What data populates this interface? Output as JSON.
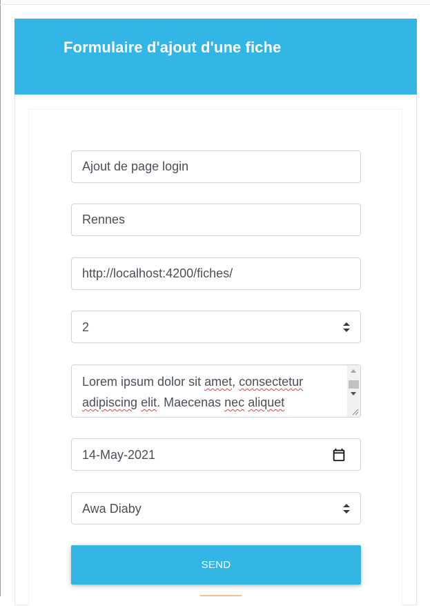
{
  "form": {
    "title": "Formulaire d'ajout d'une fiche",
    "fields": {
      "title_value": "Ajout de page login",
      "city_value": "Rennes",
      "url_value": "http://localhost:4200/fiches/",
      "number_select_value": "2",
      "description": {
        "line1_parts": [
          "Lorem ipsum dolor sit ",
          "amet",
          ", ",
          "consectetur"
        ],
        "line2_parts": [
          "adipiscing",
          " ",
          "elit",
          ". Maecenas ",
          "nec",
          " ",
          "aliquet"
        ]
      },
      "date_value": "14-May-2021",
      "person_select_value": "Awa Diaby"
    },
    "send_label": "SEND"
  },
  "icons": {
    "select_arrows": "sort-arrows-icon",
    "date_picker": "calendar-icon",
    "resize": "resize-grip-icon"
  },
  "colors": {
    "header": "#33b5e5",
    "button": "#33b5e5",
    "spellcheck": "#e53935"
  }
}
